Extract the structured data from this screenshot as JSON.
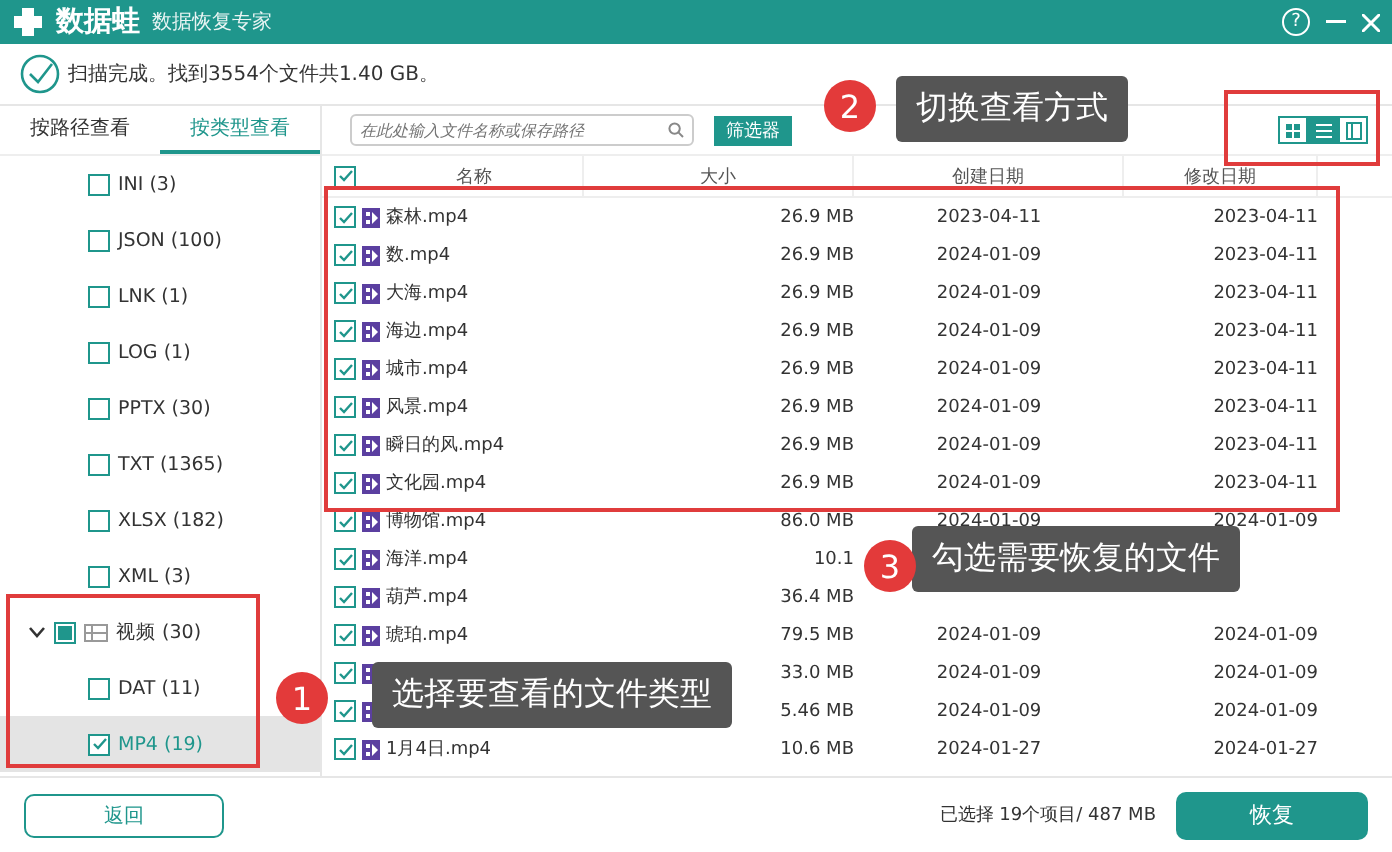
{
  "app": {
    "name": "数据蛙",
    "subtitle": "数据恢复专家",
    "help_icon": "?"
  },
  "status": {
    "message": "扫描完成。找到3554个文件共1.40 GB。"
  },
  "tabs": [
    {
      "label": "按路径查看",
      "selected": false
    },
    {
      "label": "按类型查看",
      "selected": true
    }
  ],
  "search": {
    "placeholder": "在此处输入文件名称或保存路径"
  },
  "filter_button": "筛选器",
  "view_modes": [
    {
      "kind": "grid",
      "selected": false
    },
    {
      "kind": "list",
      "selected": true
    },
    {
      "kind": "preview",
      "selected": false
    }
  ],
  "sidebar": {
    "items": [
      {
        "label": "INI (3)",
        "checked": false,
        "selected": false
      },
      {
        "label": "JSON (100)",
        "checked": false,
        "selected": false
      },
      {
        "label": "LNK (1)",
        "checked": false,
        "selected": false
      },
      {
        "label": "LOG (1)",
        "checked": false,
        "selected": false
      },
      {
        "label": "PPTX (30)",
        "checked": false,
        "selected": false
      },
      {
        "label": "TXT (1365)",
        "checked": false,
        "selected": false
      },
      {
        "label": "XLSX (182)",
        "checked": false,
        "selected": false
      },
      {
        "label": "XML (3)",
        "checked": false,
        "selected": false
      },
      {
        "label": "视频 (30)",
        "checked": false,
        "partial": true,
        "expanded": true,
        "selected": false,
        "children": [
          {
            "label": "DAT (11)",
            "checked": false,
            "selected": false
          },
          {
            "label": "MP4 (19)",
            "checked": true,
            "selected": true
          }
        ]
      }
    ]
  },
  "table": {
    "all_checked": true,
    "columns": [
      "名称",
      "大小",
      "创建日期",
      "修改日期"
    ],
    "rows": [
      {
        "checked": true,
        "name": "森林.mp4",
        "size": "26.9 MB",
        "created": "2023-04-11",
        "modified": "2023-04-11"
      },
      {
        "checked": true,
        "name": "数.mp4",
        "size": "26.9 MB",
        "created": "2024-01-09",
        "modified": "2023-04-11"
      },
      {
        "checked": true,
        "name": "大海.mp4",
        "size": "26.9 MB",
        "created": "2024-01-09",
        "modified": "2023-04-11"
      },
      {
        "checked": true,
        "name": "海边.mp4",
        "size": "26.9 MB",
        "created": "2024-01-09",
        "modified": "2023-04-11"
      },
      {
        "checked": true,
        "name": "城市.mp4",
        "size": "26.9 MB",
        "created": "2024-01-09",
        "modified": "2023-04-11"
      },
      {
        "checked": true,
        "name": "风景.mp4",
        "size": "26.9 MB",
        "created": "2024-01-09",
        "modified": "2023-04-11"
      },
      {
        "checked": true,
        "name": "瞬日的风.mp4",
        "size": "26.9 MB",
        "created": "2024-01-09",
        "modified": "2023-04-11"
      },
      {
        "checked": true,
        "name": "文化园.mp4",
        "size": "26.9 MB",
        "created": "2024-01-09",
        "modified": "2023-04-11"
      },
      {
        "checked": true,
        "name": "博物馆.mp4",
        "size": "86.0 MB",
        "created": "2024-01-09",
        "modified": "2024-01-09"
      },
      {
        "checked": true,
        "name": "海洋.mp4",
        "size": "10.1"
      },
      {
        "checked": true,
        "name": "葫芦.mp4",
        "size": "36.4 MB"
      },
      {
        "checked": true,
        "name": "琥珀.mp4",
        "size": "79.5 MB",
        "created": "2024-01-09",
        "modified": "2024-01-09"
      },
      {
        "checked": true,
        "size": "33.0 MB",
        "created": "2024-01-09",
        "modified": "2024-01-09"
      },
      {
        "checked": true,
        "size": "5.46 MB",
        "created": "2024-01-09",
        "modified": "2024-01-09"
      },
      {
        "checked": true,
        "name": "1月4日.mp4",
        "size": "10.6 MB",
        "created": "2024-01-27",
        "modified": "2024-01-27"
      }
    ]
  },
  "footer": {
    "back_button": "返回",
    "selection": "已选择 19个项目/ 487 MB",
    "recover_button": "恢复"
  },
  "callouts": [
    {
      "number": "1",
      "text": "选择要查看的文件类型"
    },
    {
      "number": "2",
      "text": "切换查看方式"
    },
    {
      "number": "3",
      "text": "勾选需要恢复的文件"
    }
  ]
}
